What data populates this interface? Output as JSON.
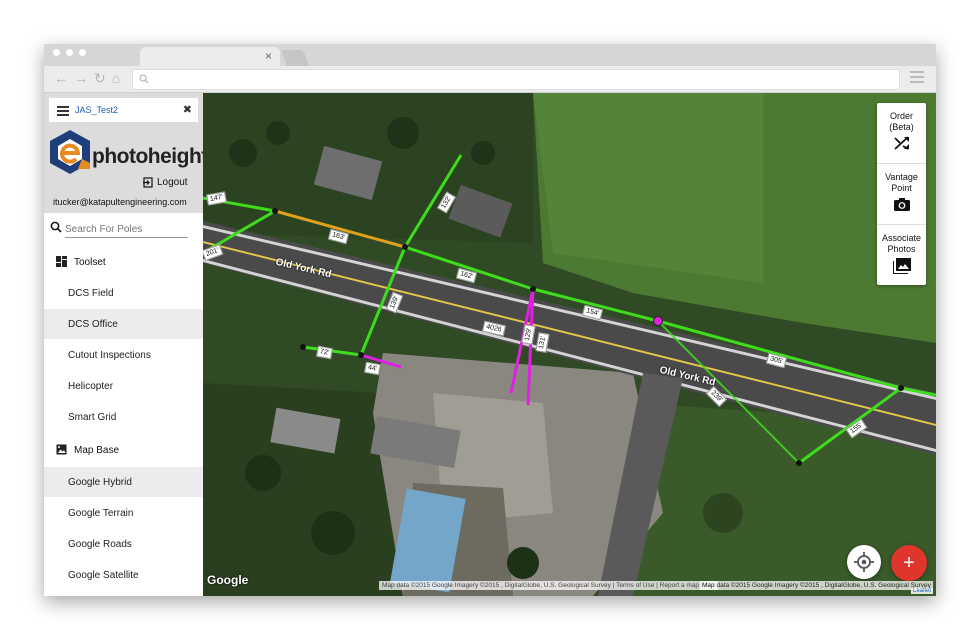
{
  "browser": {
    "tab_close": "×"
  },
  "sidebar": {
    "project_name": "JAS_Test2",
    "close_label": "✖",
    "brand": "photoheight",
    "logout_label": "Logout",
    "user_email": "itucker@katapultengineering.com",
    "search_placeholder": "Search For Poles",
    "toolset_label": "Toolset",
    "toolset_items": [
      {
        "label": "DCS Field",
        "active": false
      },
      {
        "label": "DCS Office",
        "active": true
      },
      {
        "label": "Cutout Inspections",
        "active": false
      },
      {
        "label": "Helicopter",
        "active": false
      },
      {
        "label": "Smart Grid",
        "active": false
      }
    ],
    "mapbase_label": "Map Base",
    "mapbase_items": [
      {
        "label": "Google Hybrid",
        "active": true
      },
      {
        "label": "Google Terrain",
        "active": false
      },
      {
        "label": "Google Roads",
        "active": false
      },
      {
        "label": "Google Satellite",
        "active": false
      }
    ]
  },
  "map": {
    "road_labels": [
      "Old York Rd",
      "Old York Rd"
    ],
    "span_labels": [
      "147'",
      "163'",
      "201'",
      "132'",
      "162'",
      "139'",
      "154'",
      "72'",
      "44'",
      "129'",
      "131'",
      "305'",
      "239'",
      "155'"
    ],
    "route_label": "4026",
    "google_label": "Google",
    "attribution_left": "Map data ©2015 Google Imagery ©2015 , DigitalGlobe, U.S. Geological Survey  |  Terms of Use  |  Report a map error",
    "attribution_right": "Map data ©2015 Google Imagery ©2015 , DigitalGlobe, U.S. Geological Survey",
    "leaflet_label": "Leaflet",
    "add_label": "+",
    "colors": {
      "span_green": "#3fdc1e",
      "span_orange": "#e0a020",
      "span_magenta": "#e020e0",
      "fab_red": "#e0352b"
    }
  },
  "panel": {
    "order_label": "Order (Beta)",
    "vantage_label": "Vantage Point",
    "associate_label": "Associate Photos"
  }
}
